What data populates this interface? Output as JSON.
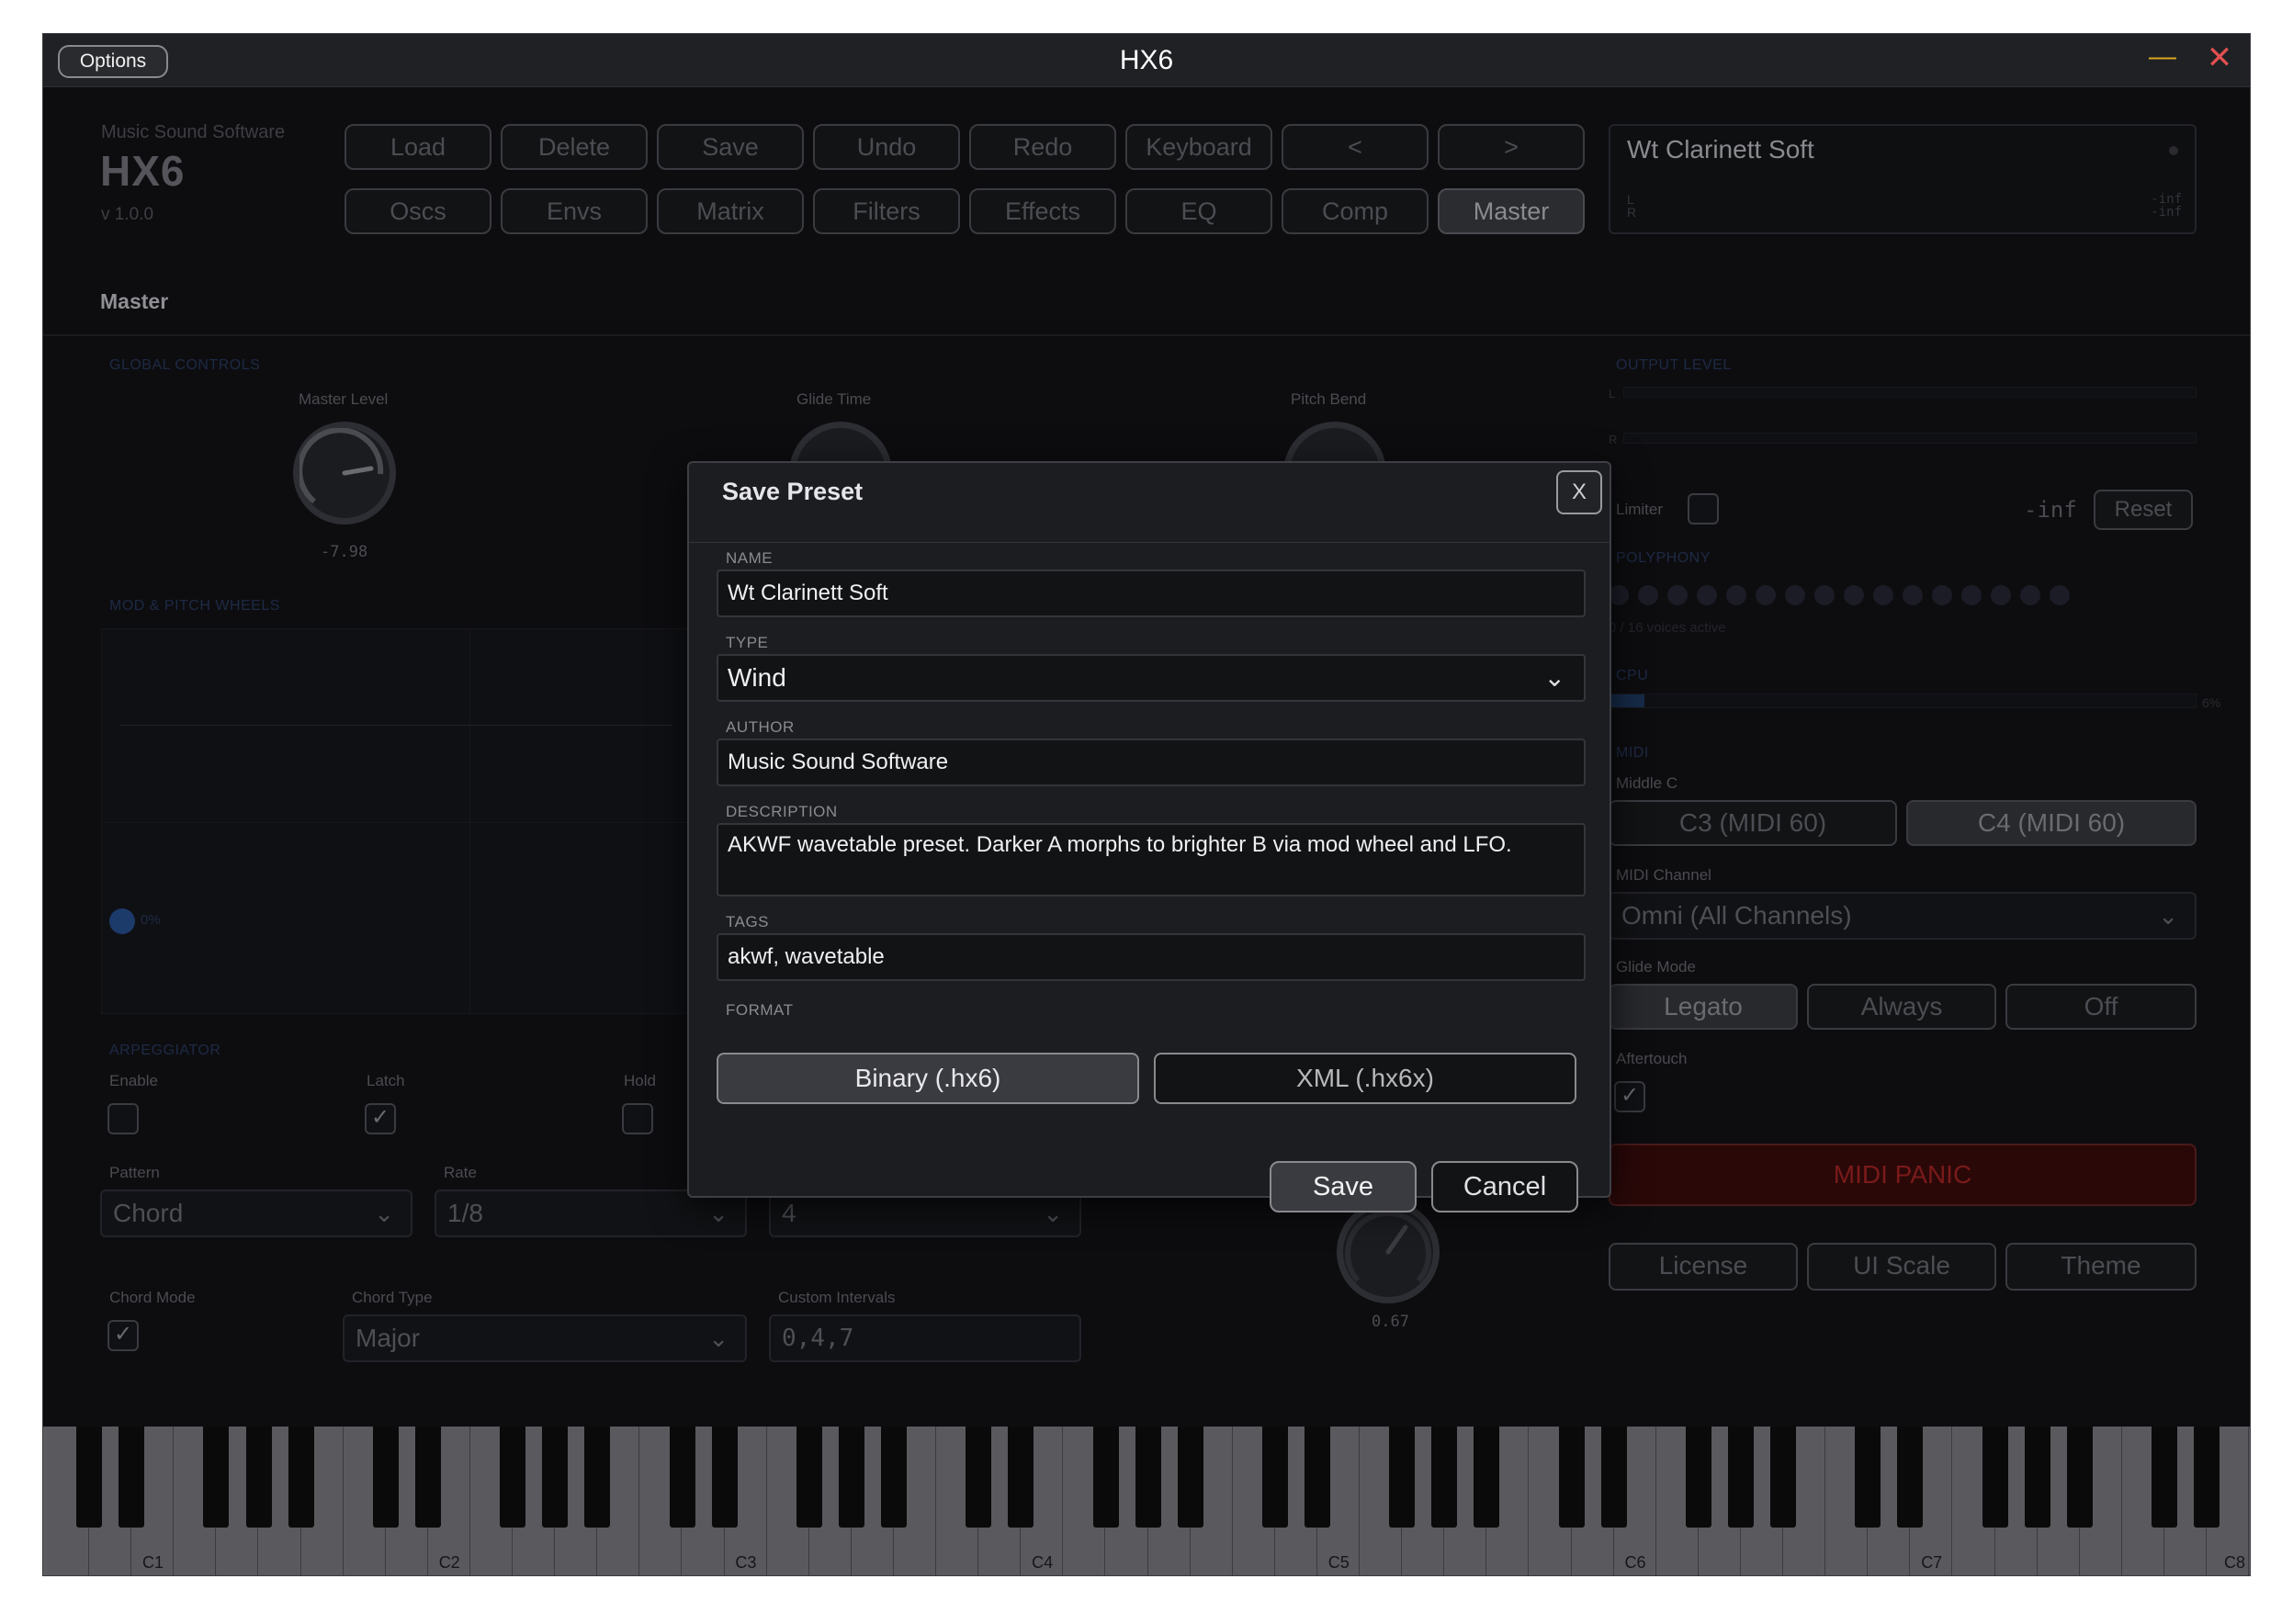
{
  "window": {
    "title": "HX6",
    "options_label": "Options",
    "minimize_glyph": "—",
    "close_glyph": "✕"
  },
  "brand": {
    "company": "Music Sound Software",
    "logo": "HX6",
    "version": "v 1.0.0"
  },
  "nav": {
    "row1": [
      "Load",
      "Delete",
      "Save",
      "Undo",
      "Redo",
      "Keyboard",
      "<",
      ">"
    ],
    "row2": [
      "Oscs",
      "Envs",
      "Matrix",
      "Filters",
      "Effects",
      "EQ",
      "Comp",
      "Master"
    ],
    "active": "Master"
  },
  "preset_display": {
    "name": "Wt Clarinett Soft",
    "l_label": "L",
    "r_label": "R",
    "l_value": "-inf",
    "r_value": "-inf"
  },
  "page": {
    "section_title": "Master"
  },
  "global_controls": {
    "heading": "GLOBAL CONTROLS",
    "master_level_label": "Master Level",
    "master_level_value": "-7.98",
    "glide_time_label": "Glide Time",
    "pitch_bend_label": "Pitch Bend"
  },
  "wheels": {
    "heading": "MOD & PITCH WHEELS",
    "mod_value": "0%"
  },
  "arpeggiator": {
    "heading": "ARPEGGIATOR",
    "enable_label": "Enable",
    "latch_label": "Latch",
    "hold_label": "Hold",
    "enable_checked": false,
    "latch_checked": true,
    "hold_checked": false,
    "pattern_label": "Pattern",
    "pattern_value": "Chord",
    "rate_label": "Rate",
    "rate_value": "1/8",
    "octaves_value": "4",
    "chord_mode_label": "Chord Mode",
    "chord_mode_checked": true,
    "chord_type_label": "Chord Type",
    "chord_type_value": "Major",
    "custom_intervals_label": "Custom Intervals",
    "custom_intervals_value": "0,4,7",
    "knob_value": "0.67",
    "check_glyph": "✓",
    "chevron_glyph": "⌵"
  },
  "output": {
    "heading": "OUTPUT LEVEL",
    "l_label": "L",
    "r_label": "R",
    "limiter_label": "Limiter",
    "level_readout": "-inf",
    "reset_label": "Reset"
  },
  "polyphony": {
    "heading": "POLYPHONY",
    "voices_text": "0 / 16 voices active",
    "voice_count": 16
  },
  "cpu": {
    "heading": "CPU",
    "percent_text": "6%",
    "level": 0.06
  },
  "midi": {
    "heading": "MIDI",
    "middle_c_label": "Middle C",
    "middle_c_options": [
      "C3 (MIDI 60)",
      "C4 (MIDI 60)"
    ],
    "middle_c_selected": "C4 (MIDI 60)",
    "channel_label": "MIDI Channel",
    "channel_value": "Omni (All Channels)",
    "glide_mode_label": "Glide Mode",
    "glide_modes": [
      "Legato",
      "Always",
      "Off"
    ],
    "glide_selected": "Legato",
    "aftertouch_label": "Aftertouch",
    "aftertouch_checked": true,
    "panic_label": "MIDI PANIC"
  },
  "footer_buttons": [
    "License",
    "UI Scale",
    "Theme"
  ],
  "keyboard": {
    "octave_labels": [
      "C1",
      "C2",
      "C3",
      "C4",
      "C5",
      "C6",
      "C7",
      "C8"
    ]
  },
  "dialog": {
    "title": "Save Preset",
    "close_label": "X",
    "name_label": "NAME",
    "name_value": "Wt Clarinett Soft",
    "type_label": "TYPE",
    "type_value": "Wind",
    "author_label": "AUTHOR",
    "author_value": "Music Sound Software",
    "description_label": "DESCRIPTION",
    "description_value": "AKWF wavetable preset. Darker A morphs to brighter B via mod wheel and LFO.",
    "tags_label": "TAGS",
    "tags_value": "akwf, wavetable",
    "format_label": "FORMAT",
    "format_options": [
      "Binary (.hx6)",
      "XML (.hx6x)"
    ],
    "format_selected": "Binary (.hx6)",
    "save_label": "Save",
    "cancel_label": "Cancel"
  },
  "colors": {
    "background": "#0d0d10",
    "dialog": "#1c1d20",
    "panic": "#2a0808",
    "minimize": "#d9a520",
    "close": "#e05050"
  }
}
